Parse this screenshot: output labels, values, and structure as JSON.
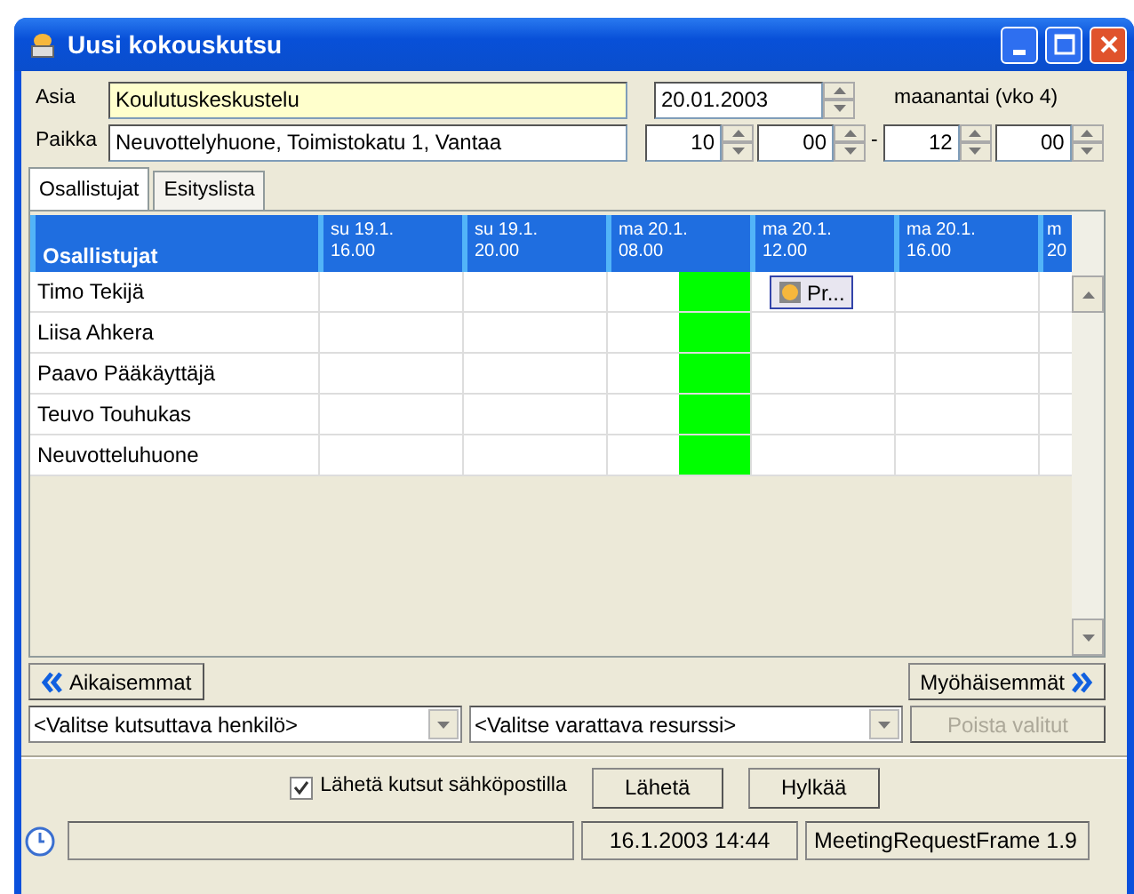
{
  "window": {
    "title": "Uusi kokouskutsu"
  },
  "form": {
    "subject_label": "Asia",
    "subject": "Koulutuskeskustelu",
    "location_label": "Paikka",
    "location": "Neuvottelyhuone, Toimistokatu 1, Vantaa",
    "date": "20.01.2003",
    "weekday": "maanantai (vko 4)",
    "start_hour": "10",
    "start_minute": "00",
    "separator": "-",
    "end_hour": "12",
    "end_minute": "00"
  },
  "tabs": [
    {
      "label": "Osallistujat",
      "selected": true
    },
    {
      "label": "Esityslista",
      "selected": false
    }
  ],
  "schedule": {
    "name_header": "Osallistujat",
    "columns": [
      {
        "day": "su 19.1.",
        "time": "16.00",
        "slots": [
          {
            "meeting": false
          },
          {
            "meeting": false
          }
        ]
      },
      {
        "day": "su 19.1.",
        "time": "20.00",
        "slots": [
          {
            "meeting": false
          },
          {
            "meeting": false
          }
        ]
      },
      {
        "day": "ma 20.1.",
        "time": "08.00",
        "slots": [
          {
            "meeting": false
          },
          {
            "meeting": true
          }
        ]
      },
      {
        "day": "ma 20.1.",
        "time": "12.00",
        "slots": [
          {
            "meeting": false
          },
          {
            "meeting": false
          }
        ]
      },
      {
        "day": "ma 20.1.",
        "time": "16.00",
        "slots": [
          {
            "meeting": false
          },
          {
            "meeting": false
          }
        ]
      },
      {
        "day": "m",
        "time": "20",
        "slots": [
          {
            "meeting": false
          }
        ]
      }
    ],
    "rows": [
      {
        "name": "Timo Tekijä",
        "cells": [
          {
            "kind": "free"
          },
          {
            "kind": "free"
          },
          {
            "kind": "free"
          },
          {
            "kind": "appointment",
            "label": "Pr..."
          },
          {
            "kind": "free"
          },
          {
            "kind": "free"
          }
        ]
      },
      {
        "name": "Liisa Ahkera",
        "cells": [
          {
            "kind": "free"
          },
          {
            "kind": "free"
          },
          {
            "kind": "free"
          },
          {
            "kind": "free"
          },
          {
            "kind": "free"
          },
          {
            "kind": "free"
          }
        ]
      },
      {
        "name": "Paavo Pääkäyttäjä",
        "cells": [
          {
            "kind": "free"
          },
          {
            "kind": "free"
          },
          {
            "kind": "free"
          },
          {
            "kind": "free"
          },
          {
            "kind": "free"
          },
          {
            "kind": "free"
          }
        ]
      },
      {
        "name": "Teuvo Touhukas",
        "cells": [
          {
            "kind": "free"
          },
          {
            "kind": "free"
          },
          {
            "kind": "free"
          },
          {
            "kind": "free"
          },
          {
            "kind": "free"
          },
          {
            "kind": "free"
          }
        ]
      },
      {
        "name": "Neuvotteluhuone",
        "cells": [
          {
            "kind": "free"
          },
          {
            "kind": "free"
          },
          {
            "kind": "free"
          },
          {
            "kind": "free"
          },
          {
            "kind": "free"
          },
          {
            "kind": "free"
          }
        ]
      }
    ]
  },
  "navigation": {
    "earlier": "Aikaisemmat",
    "later": "Myöhäisemmät"
  },
  "pickers": {
    "person": "<Valitse kutsuttava henkilö>",
    "resource": "<Valitse varattava resurssi>",
    "remove": {
      "label": "Poista valitut",
      "disabled": true
    }
  },
  "footer": {
    "email": {
      "label": "Lähetä kutsut sähköpostilla",
      "checked": true
    },
    "buttons": [
      "Lähetä",
      "Hylkää"
    ]
  },
  "status_bar": {
    "timestamp": "16.1.2003 14:44",
    "frame": "MeetingRequestFrame 1.9"
  }
}
